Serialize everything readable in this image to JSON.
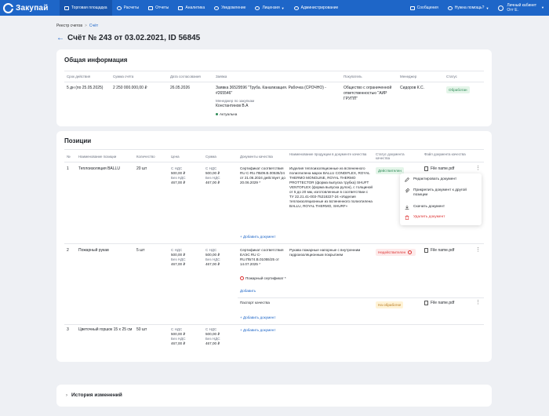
{
  "app": {
    "logo": "Закупай"
  },
  "nav": [
    {
      "label": "Торговая площадка",
      "icon": "shop-icon",
      "active": true
    },
    {
      "label": "Расчеты",
      "icon": "calc-icon"
    },
    {
      "label": "Отчеты",
      "icon": "reports-icon"
    },
    {
      "label": "Аналитика",
      "icon": "analytics-icon"
    },
    {
      "label": "Уведомление",
      "icon": "bell-icon"
    },
    {
      "label": "Лицензия",
      "icon": "license-icon"
    },
    {
      "label": "Администрирование",
      "icon": "admin-icon"
    }
  ],
  "nav_right": {
    "messages": "Сообщения",
    "help": "Нужна помощь?",
    "account_title": "Личный кабинет",
    "account_user": "Отт Е."
  },
  "breadcrumb": {
    "root": "Реестр счетов",
    "current": "Счёт"
  },
  "page_title": "Счёт № 243 от 03.02.2021, ID 56845",
  "general": {
    "title": "Общая информация",
    "headers": {
      "term": "Срок действия",
      "sum": "Сумма счёта",
      "approval_date": "Дата согласования",
      "request": "Заявка",
      "buyer": "Покупатель",
      "manager": "Менеджер",
      "status": "Статус"
    },
    "term": "5 дн (по 25.05.2025)",
    "sum": "2 250 000.000,00 ₽",
    "approval_date": "26.05.2026",
    "request_text": "Заявка 36529596 \"Труба. Канализация. Рабочка (СРОЧНО) - #265546\"",
    "request_manager_label": "Менеджер по закупкам",
    "request_manager": "Константинов В.А",
    "request_state": "Актуальна",
    "buyer": "Общество с ограниченной ответственностью \"АИР ГРУПП\"",
    "manager": "Сидоров К.С.",
    "status": "Обработан"
  },
  "positions": {
    "title": "Позиции",
    "headers": {
      "num": "№",
      "name": "Наименование позиции",
      "qty": "Количество",
      "price": "Цена",
      "sum": "Сумма",
      "docs": "Документы качества",
      "product_name": "Наименование продукции в документе качества",
      "doc_status": "Статус документа качества",
      "file": "Файл документа качества"
    },
    "rows": [
      {
        "num": "1",
        "name": "Теплоизоляция BALLU",
        "qty": "20 шт",
        "price_vat_label": "С НДС",
        "price_vat": "500,00 ₽",
        "price_novat_label": "Без НДС",
        "price_novat": "467,00 ₽",
        "sum_vat_label": "С НДС",
        "sum_vat": "500,00 ₽",
        "sum_novat_label": "Без НДС",
        "sum_novat": "467,00 ₽",
        "doc": "Сертификат соответствия RU С-RU.ПБ09.В.00535/24 от 21.06.2024 действует до 20.06.2029 *",
        "product": "Изделия теплоизоляционные из вспененного полиэтилена марок BALLU CONDIFLEX, ROYAL THERMO MONOLINE, ROYAL THERMO PROTTECTOR (форма выпуска трубка) SHUFT VENTOFLEX (форма выпуска рулон), с толщиной от 5 до 20 мм, изготовленные в соответствии с ТУ 22.21.41-003-75218227-24 «Изделия теплоизоляционные из вспененного полиэтилена BALLU, ROYAL THERMO, SHURF»",
        "status": "Действителен",
        "file": "File name.pdf",
        "add_doc": "Добавить документ"
      },
      {
        "num": "2",
        "name": "Пожарный рукав",
        "qty": "5 шт",
        "price_vat_label": "С НДС",
        "price_vat": "500,00 ₽",
        "price_novat_label": "Без НДС",
        "price_novat": "467,00 ₽",
        "sum_vat_label": "С НДС",
        "sum_vat": "500,00 ₽",
        "sum_novat_label": "Без НДС",
        "sum_novat": "467,00 ₽",
        "doc": "Сертификат соответствия ЕАЭС RU C-RU.ПБ74.В.01055/25 от 14.07.2025 *",
        "product": "Рукава пожарные напорные с внутренним гидроизоляционным покрытием",
        "status": "Недействителен",
        "file": "File name.pdf",
        "warn_doc": "Пожарный сертификат *",
        "warn_add": "Добавить",
        "doc2": "Паспорт качества",
        "status2": "На обработке",
        "file2": "File name.pdf",
        "add_doc": "Добавить документ"
      },
      {
        "num": "3",
        "name": "Цветочный горшок 15 х 25 см",
        "qty": "50 шт",
        "price_vat_label": "С НДС",
        "price_vat": "500,00 ₽",
        "price_novat_label": "Без НДС",
        "price_novat": "467,00 ₽",
        "sum_vat_label": "С НДС",
        "sum_vat": "500,00 ₽",
        "sum_novat_label": "Без НДС",
        "sum_novat": "467,00 ₽",
        "add_doc": "Добавить документ"
      }
    ]
  },
  "context_menu": [
    {
      "label": "Редактировать документ",
      "icon": "pencil-icon"
    },
    {
      "label": "Прикрепить документ к другой позиции",
      "icon": "paperclip-icon"
    },
    {
      "label": "Скачать документ",
      "icon": "download-icon"
    },
    {
      "label": "Удалить документ",
      "icon": "trash-icon",
      "danger": true
    }
  ],
  "history": {
    "title": "История изменений"
  },
  "colors": {
    "brand": "#1e66c8",
    "success": "#2e8b57",
    "danger": "#dd3333",
    "warning": "#b7791f"
  }
}
